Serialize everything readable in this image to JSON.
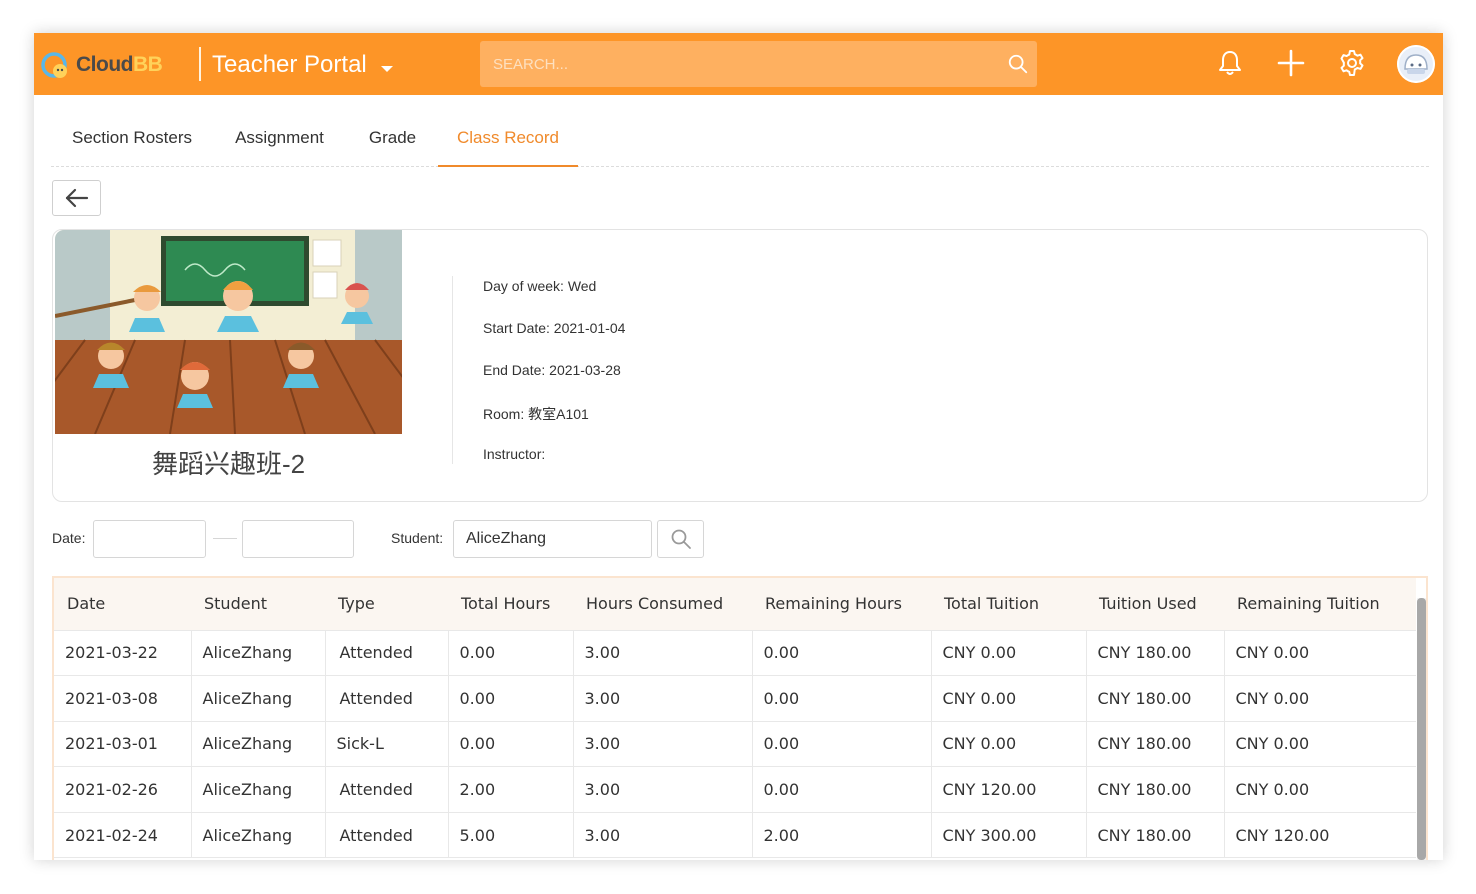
{
  "app": {
    "logo_text_part1": "Cloud",
    "logo_text_part2": "BB",
    "portal_title": "Teacher Portal",
    "search_placeholder": "SEARCH...",
    "icons": [
      "bell-icon",
      "plus-icon",
      "gear-icon",
      "avatar"
    ]
  },
  "tabs": [
    {
      "label": "Section Rosters",
      "active": false
    },
    {
      "label": "Assignment",
      "active": false
    },
    {
      "label": "Grade",
      "active": false
    },
    {
      "label": "Class Record",
      "active": true
    }
  ],
  "class_info": {
    "name": "舞蹈兴趣班-2",
    "day_of_week": "Day of week: Wed",
    "start_date": "Start Date: 2021-01-04",
    "end_date": "End Date: 2021-03-28",
    "room": "Room: 教室A101",
    "instructor": "Instructor:"
  },
  "filter": {
    "date_label": "Date:",
    "date_from": "",
    "date_to": "",
    "student_label": "Student:",
    "student_value": "AliceZhang"
  },
  "table": {
    "headers": [
      "Date",
      "Student",
      "Type",
      "Total Hours",
      "Hours Consumed",
      "Remaining Hours",
      "Total Tuition",
      "Tuition Used",
      "Remaining Tuition"
    ],
    "rows": [
      [
        "2021-03-22",
        "AliceZhang",
        "Attended",
        "0.00",
        "3.00",
        "0.00",
        "CNY 0.00",
        "CNY 180.00",
        "CNY 0.00"
      ],
      [
        "2021-03-08",
        "AliceZhang",
        "Attended",
        "0.00",
        "3.00",
        "0.00",
        "CNY 0.00",
        "CNY 180.00",
        "CNY 0.00"
      ],
      [
        "2021-03-01",
        "AliceZhang",
        "Sick-L",
        "0.00",
        "3.00",
        "0.00",
        "CNY 0.00",
        "CNY 180.00",
        "CNY 0.00"
      ],
      [
        "2021-02-26",
        "AliceZhang",
        "Attended",
        "2.00",
        "3.00",
        "0.00",
        "CNY 120.00",
        "CNY 180.00",
        "CNY 0.00"
      ],
      [
        "2021-02-24",
        "AliceZhang",
        "Attended",
        "5.00",
        "3.00",
        "2.00",
        "CNY 300.00",
        "CNY 180.00",
        "CNY 120.00"
      ]
    ]
  },
  "colors": {
    "brand_orange": "#fd9527",
    "active_tab": "#f08a2b",
    "table_header_bg": "#fbf6f1"
  }
}
